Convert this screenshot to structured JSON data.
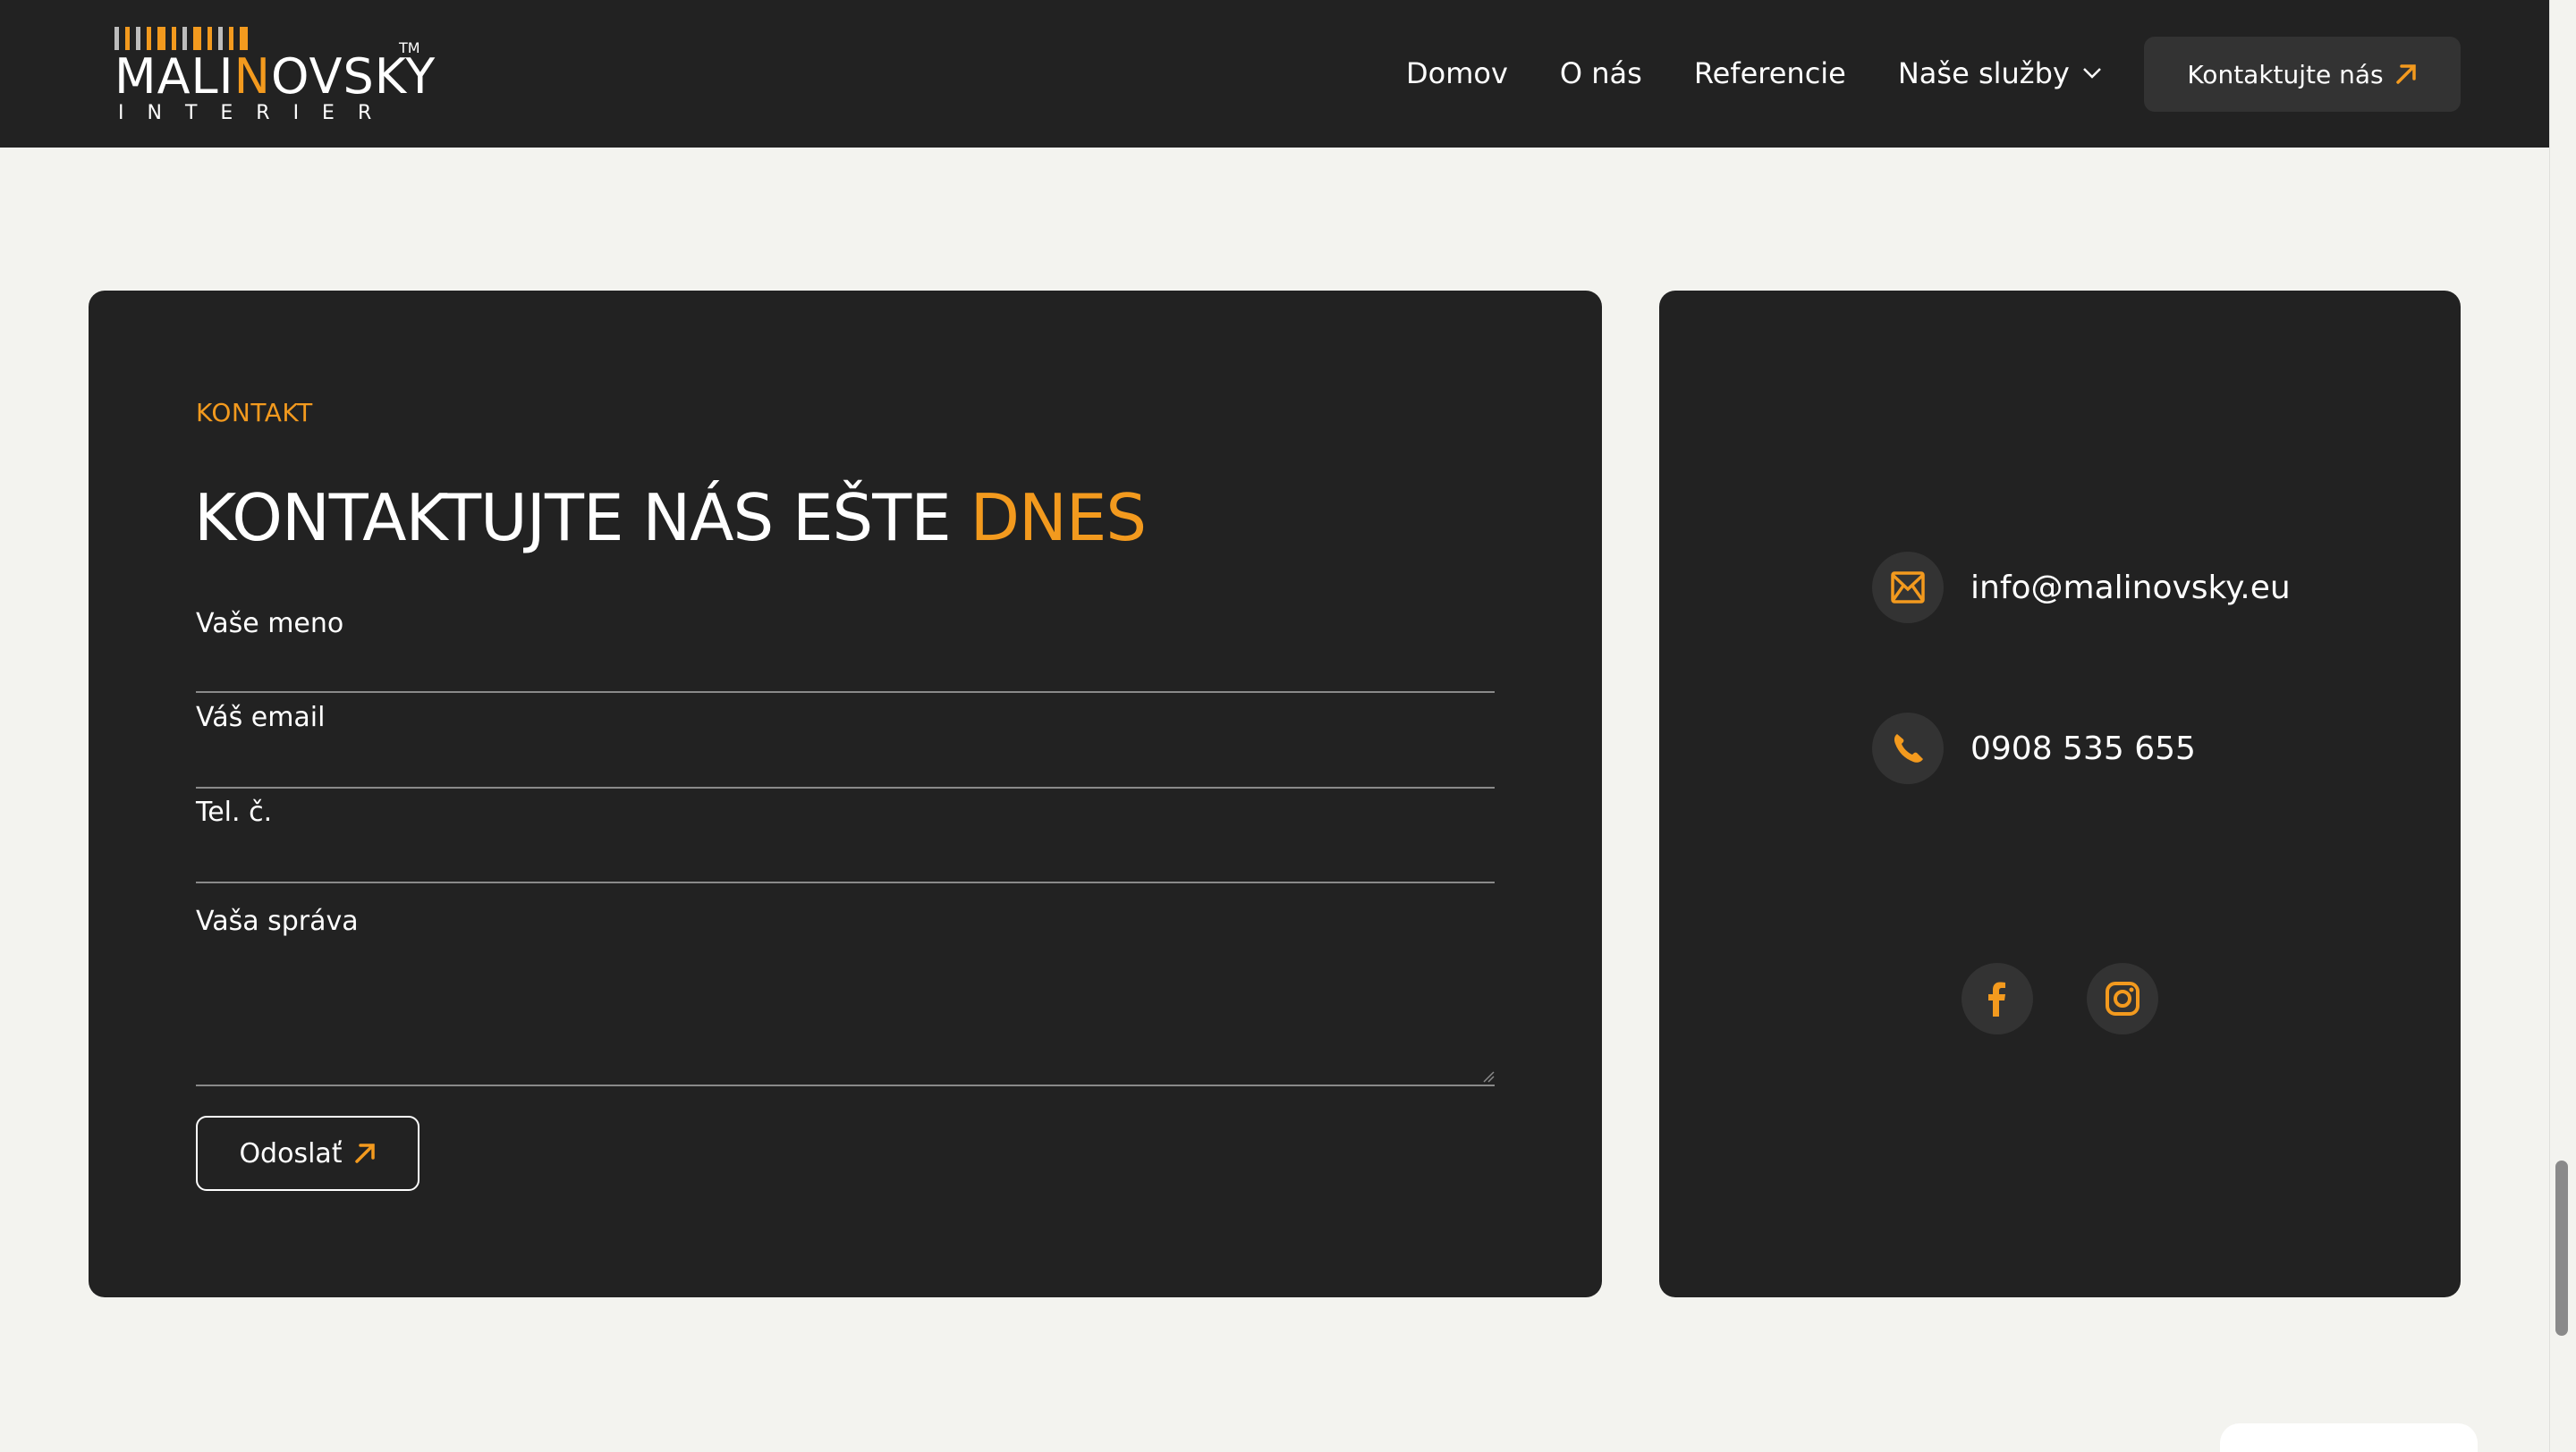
{
  "header": {
    "logo": {
      "word_pre": "MAL",
      "word_accent": "N",
      "word_post": "OVSKY",
      "i_letter": "I",
      "trademark": "TM",
      "subtitle": "INTERIER"
    },
    "nav": [
      {
        "label": "Domov"
      },
      {
        "label": "O nás"
      },
      {
        "label": "Referencie"
      },
      {
        "label": "Naše služby"
      }
    ],
    "cta_label": "Kontaktujte nás"
  },
  "form": {
    "eyebrow": "KONTAKT",
    "headline_main": "KONTAKTUJTE NÁS EŠTE ",
    "headline_accent": "DNES",
    "fields": {
      "name_placeholder": "Vaše meno",
      "email_placeholder": "Váš email",
      "phone_placeholder": "Tel. č.",
      "message_placeholder": "Vaša správa"
    },
    "submit_label": "Odoslať"
  },
  "info": {
    "email": "info@malinovsky.eu",
    "phone": "0908 535 655",
    "icons": [
      "mail-icon",
      "phone-icon",
      "facebook-icon",
      "instagram-icon"
    ]
  },
  "colors": {
    "accent": "#f39a1e",
    "dark": "#222222",
    "background": "#f3f3ef"
  }
}
